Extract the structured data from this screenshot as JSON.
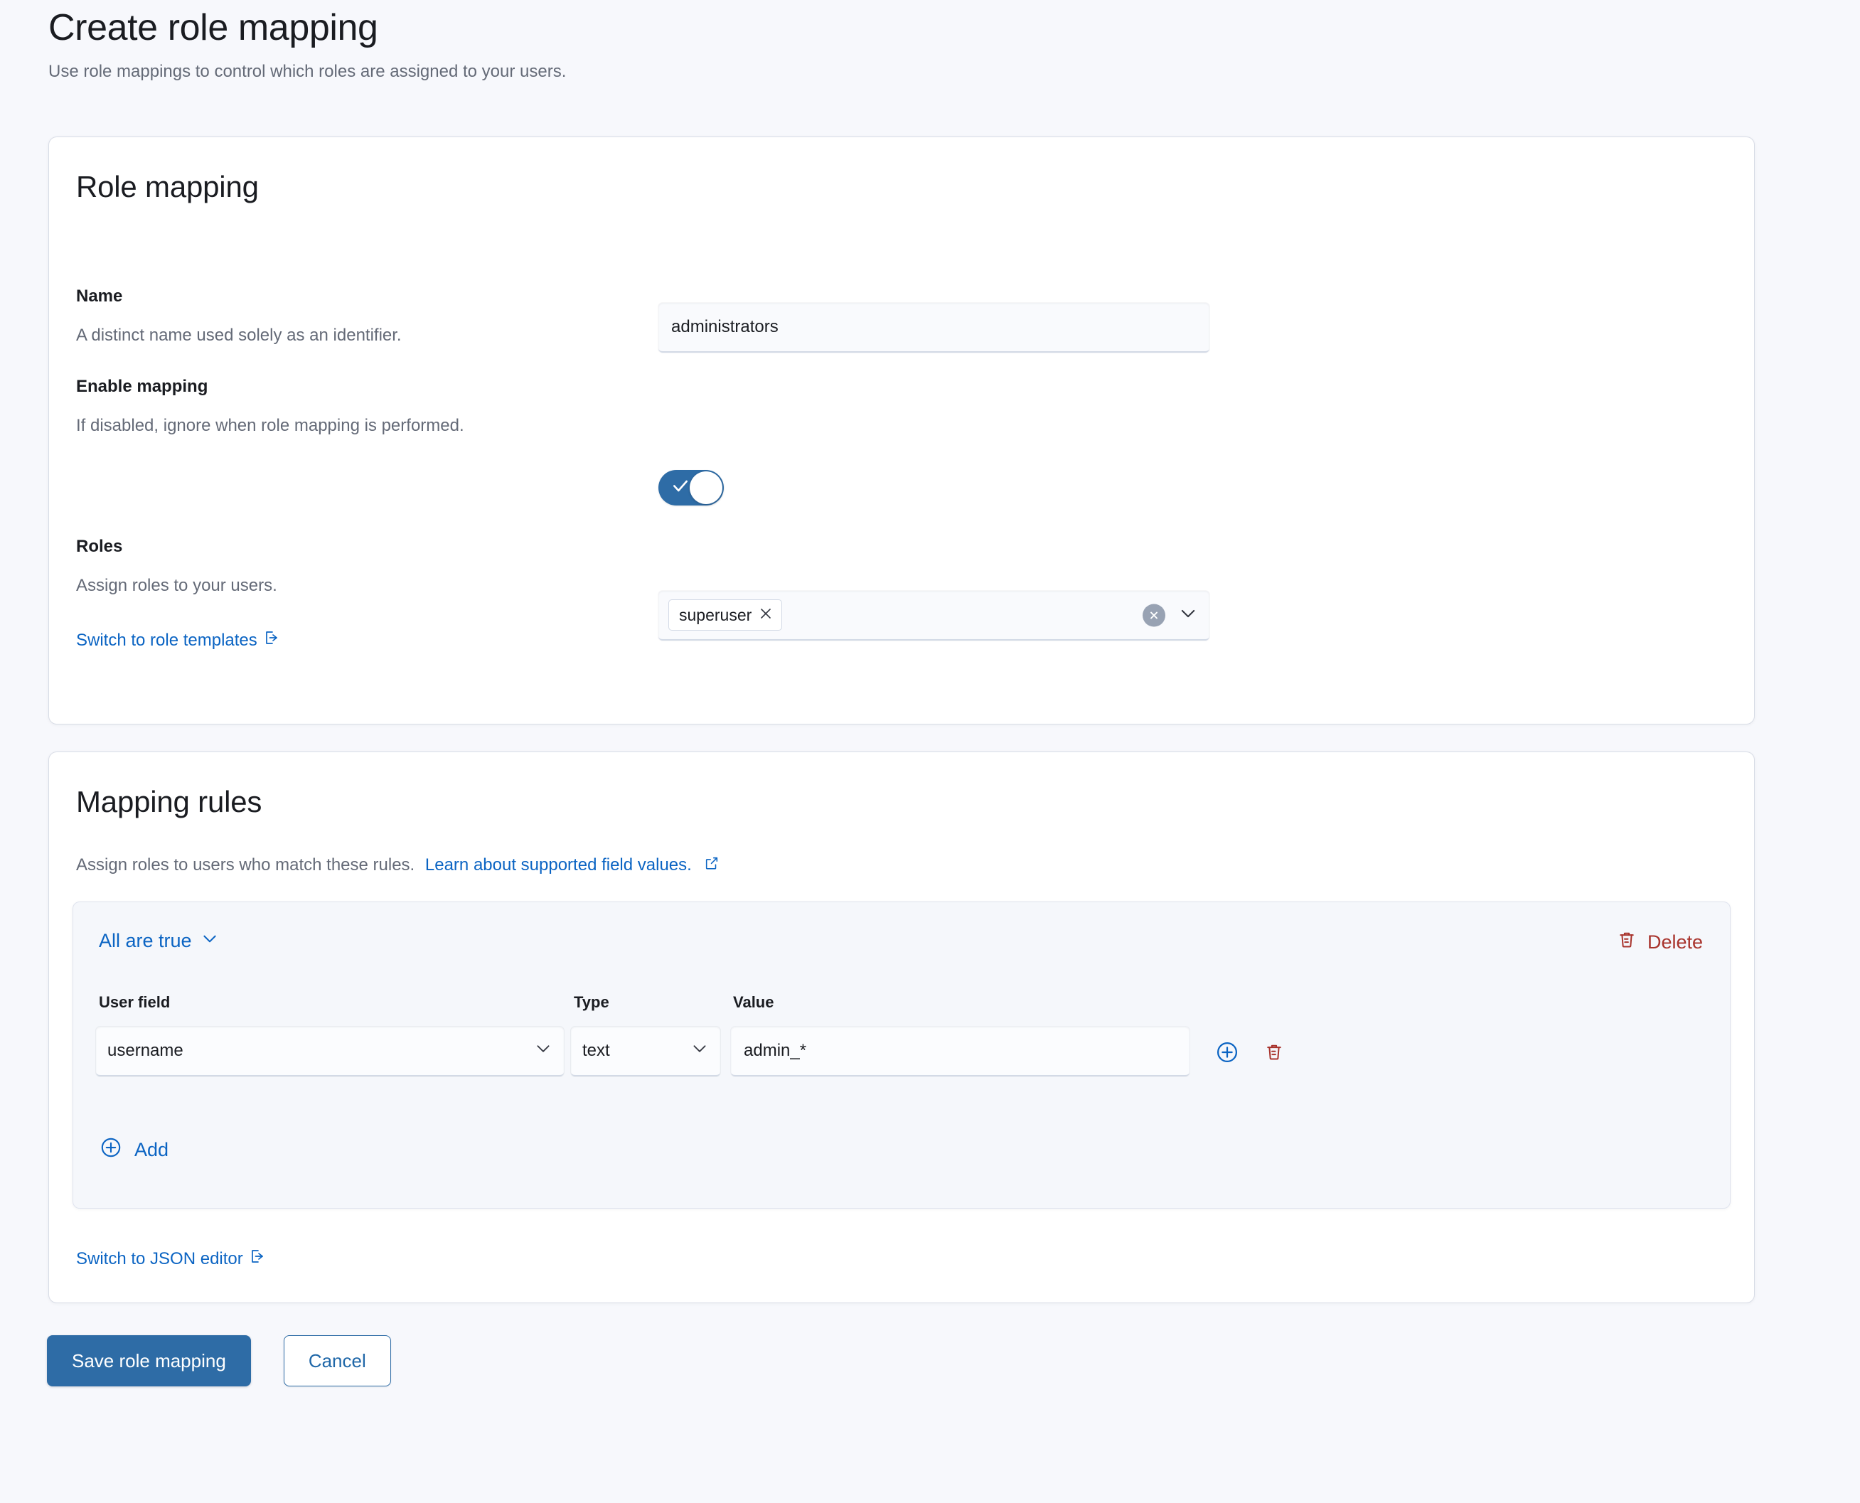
{
  "header": {
    "title": "Create role mapping",
    "subtitle": "Use role mappings to control which roles are assigned to your users."
  },
  "role_mapping_panel": {
    "title": "Role mapping",
    "name_field": {
      "label": "Name",
      "help": "A distinct name used solely as an identifier.",
      "value": "administrators",
      "placeholder": ""
    },
    "enable_mapping": {
      "label": "Enable mapping",
      "help": "If disabled, ignore when role mapping is performed.",
      "checked": true
    },
    "roles_field": {
      "label": "Roles",
      "help": "Assign roles to your users.",
      "selected": [
        "superuser"
      ],
      "placeholder": ""
    },
    "switch_link": "Switch to role templates"
  },
  "mapping_rules_panel": {
    "title": "Mapping rules",
    "description": "Assign roles to users who match these rules.",
    "learn_link": "Learn about supported field values.",
    "group": {
      "condition": "All are true",
      "delete_label": "Delete",
      "columns": {
        "user_field": "User field",
        "type": "Type",
        "value": "Value"
      },
      "rows": [
        {
          "user_field": "username",
          "type": "text",
          "value": "admin_*"
        }
      ],
      "add_label": "Add"
    },
    "switch_link": "Switch to JSON editor"
  },
  "footer": {
    "save_label": "Save role mapping",
    "cancel_label": "Cancel"
  },
  "colors": {
    "page_bg": "#f7f8fc",
    "panel_bg": "#ffffff",
    "accent_blue": "#0b64c3",
    "primary_button": "#2e6ca6",
    "danger_red": "#a8332c",
    "group_bg": "#f5f7fb"
  }
}
